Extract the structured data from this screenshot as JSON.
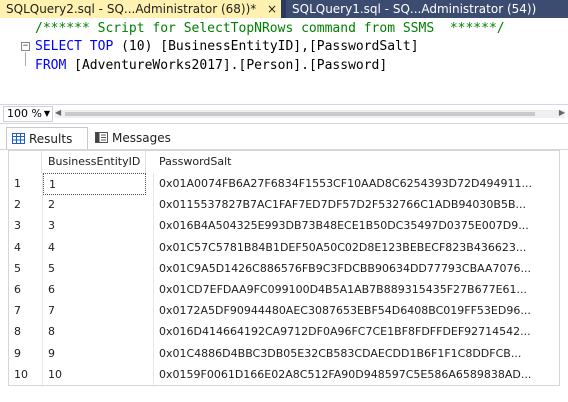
{
  "tabs": [
    {
      "label": "SQLQuery2.sql - SQ...Administrator (68))*",
      "active": true
    },
    {
      "label": "SQLQuery1.sql - SQ...Administrator (54))",
      "active": false
    }
  ],
  "tab_close_glyph": "×",
  "editor": {
    "comment": "/****** Script for SelectTopNRows command from SSMS  ******/",
    "select_kw": "SELECT TOP",
    "select_rest": " (10) [BusinessEntityID],[PasswordSalt]",
    "from_kw": "FROM",
    "from_rest": " [AdventureWorks2017].[Person].[Password]",
    "collapse_glyph": "−"
  },
  "zoom": {
    "value": "100 %"
  },
  "results_tabs": [
    {
      "label": "Results",
      "icon": "grid-icon"
    },
    {
      "label": "Messages",
      "icon": "messages-icon"
    }
  ],
  "grid": {
    "columns": [
      "",
      "BusinessEntityID",
      "PasswordSalt"
    ],
    "rows": [
      {
        "n": "1",
        "id": "1",
        "salt": "0x01A0074FB6A27F6834F1553CF10AAD8C6254393D72D494911..."
      },
      {
        "n": "2",
        "id": "2",
        "salt": "0x0115537827B7AC1FAF7ED7DF57D2F532766C1ADB94030B5B..."
      },
      {
        "n": "3",
        "id": "3",
        "salt": "0x016B4A504325E993DB73B48ECE1B50DC35497D0375E007D9..."
      },
      {
        "n": "4",
        "id": "4",
        "salt": "0x01C57C5781B84B1DEF50A50C02D8E123BEBECF823B436623..."
      },
      {
        "n": "5",
        "id": "5",
        "salt": "0x01C9A5D1426C886576FB9C3FDCBB90634DD77793CBAA7076..."
      },
      {
        "n": "6",
        "id": "6",
        "salt": "0x01CD7EFDAA9FC099100D4B5A1AB7B889315435F27B677E61..."
      },
      {
        "n": "7",
        "id": "7",
        "salt": "0x0172A5DF90944480AEC3087653EBF54D6408BC019FF53ED96..."
      },
      {
        "n": "8",
        "id": "8",
        "salt": "0x016D414664192CA9712DF0A96FC7CE1BF8FDFFDEF92714542..."
      },
      {
        "n": "9",
        "id": "9",
        "salt": "0x01C4886D4BBC3DB05E32CB583CDAECDD1B6F1F1C8DDFCB..."
      },
      {
        "n": "10",
        "id": "10",
        "salt": "0x0159F0061D166E02A8C512FA90D948597C5E586A6589838AD..."
      }
    ]
  }
}
